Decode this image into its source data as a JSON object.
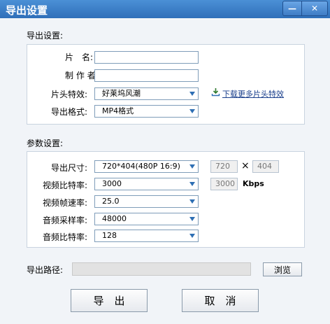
{
  "window": {
    "title": "导出设置",
    "minimize_glyph": "—",
    "close_glyph": "✕"
  },
  "export_settings": {
    "section_title": "导出设置:",
    "name_label": "片　名:",
    "author_label": "制 作 者:",
    "intro_effect_label": "片头特效:",
    "intro_effect_value": "好莱坞风潮",
    "format_label": "导出格式:",
    "format_value": "MP4格式",
    "download_link": "下载更多片头特效"
  },
  "params": {
    "section_title": "参数设置:",
    "size_label": "导出尺寸:",
    "size_value": "720*404(480P 16:9)",
    "width": "720",
    "times": "×",
    "height": "404",
    "video_bitrate_label": "视频比特率:",
    "video_bitrate_value": "3000",
    "video_bitrate_readout": "3000",
    "kbps": "Kbps",
    "fps_label": "视频帧速率:",
    "fps_value": "25.0",
    "sample_rate_label": "音频采样率:",
    "sample_rate_value": "48000",
    "audio_bitrate_label": "音频比特率:",
    "audio_bitrate_value": "128"
  },
  "path": {
    "label": "导出路径:",
    "browse": "浏览"
  },
  "buttons": {
    "export": "导　出",
    "cancel": "取　消"
  },
  "colors": {
    "titlebar": "#2f6fb9",
    "link": "#1a3f8c",
    "dropdown_arrow": "#2e6fb4"
  },
  "icons": {
    "download": "download-icon",
    "dropdown": "chevron-down-icon"
  }
}
